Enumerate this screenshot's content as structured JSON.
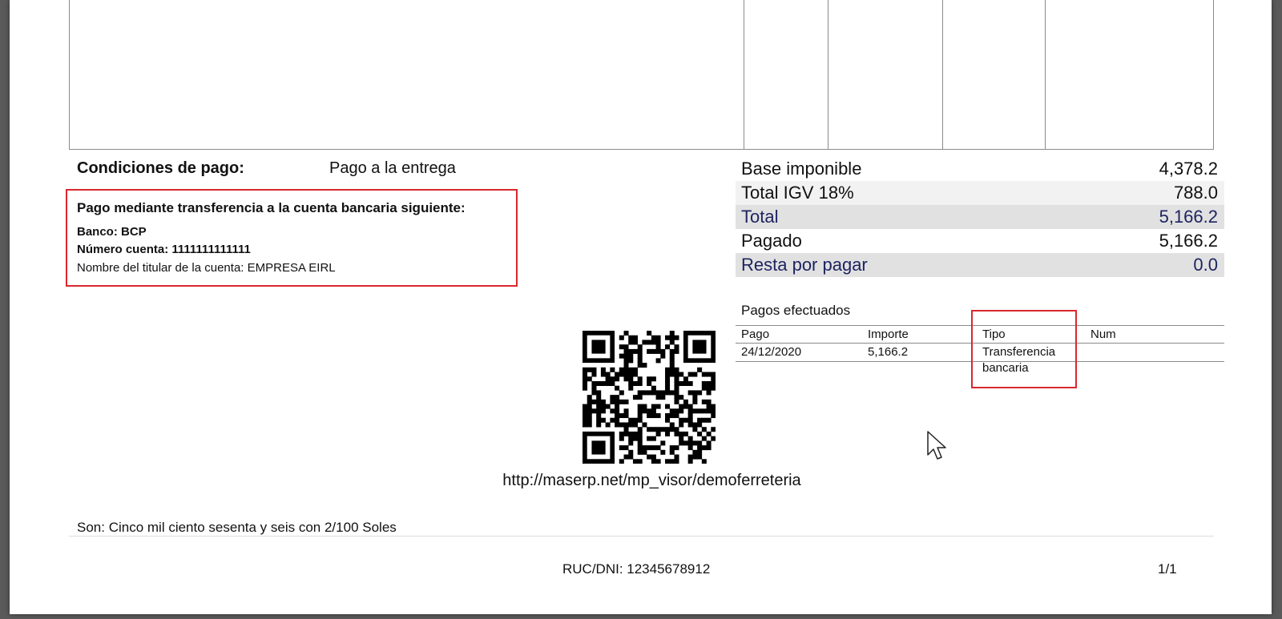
{
  "payment_conditions": {
    "label": "Condiciones de pago:",
    "value": "Pago a la entrega"
  },
  "bank_box": {
    "title": "Pago mediante transferencia a la cuenta bancaria siguiente:",
    "bank": "Banco: BCP",
    "account": "Número cuenta: 1111111111111",
    "holder": "Nombre del titular de la cuenta: EMPRESA EIRL"
  },
  "totals": [
    {
      "label": "Base imponible",
      "value": "4,378.2"
    },
    {
      "label": "Total IGV 18%",
      "value": "788.0"
    },
    {
      "label": "Total",
      "value": "5,166.2"
    },
    {
      "label": "Pagado",
      "value": "5,166.2"
    },
    {
      "label": "Resta por pagar",
      "value": "0.0"
    }
  ],
  "payments": {
    "title": "Pagos efectuados",
    "headers": [
      "Pago",
      "Importe",
      "Tipo",
      "Num"
    ],
    "rows": [
      {
        "pago": "24/12/2020",
        "importe": "5,166.2",
        "tipo_line1": "Transferencia",
        "tipo_line2": "bancaria",
        "num": ""
      }
    ]
  },
  "url": "http://maserp.net/mp_visor/demoferreteria",
  "amount_in_words": "Son: Cinco mil ciento sesenta y seis con 2/100 Soles",
  "footer": {
    "ruc": "RUC/DNI: 12345678912",
    "page": "1/1"
  },
  "colors": {
    "highlight_border": "#d9282e",
    "total_text": "#1e2460",
    "total_shade": "#e1e1e1"
  }
}
